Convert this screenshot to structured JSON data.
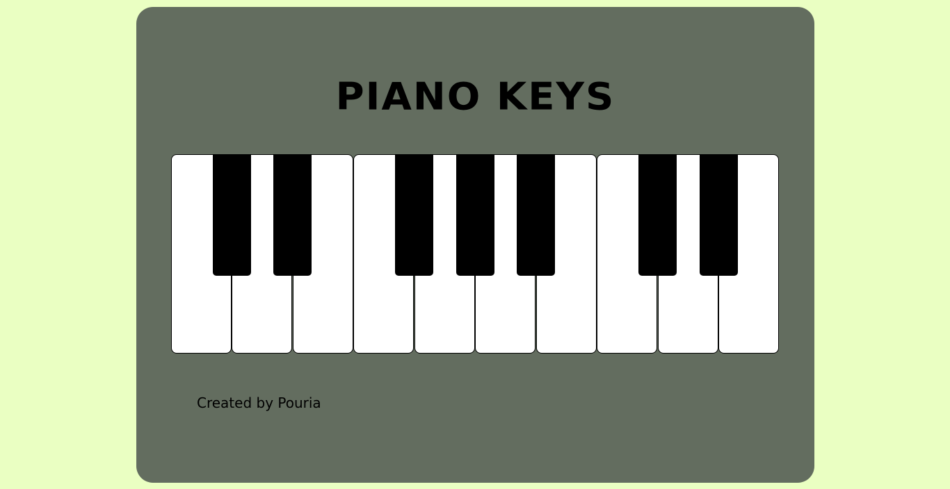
{
  "title": "PIANO KEYS",
  "footer": {
    "credit": "Created by Pouria"
  },
  "piano": {
    "white_keys": 10,
    "black_keys": 7,
    "colors": {
      "white_key": "#ffffff",
      "black_key": "#000000",
      "card_background": "#636d5f",
      "page_background": "#eaffc2"
    }
  }
}
